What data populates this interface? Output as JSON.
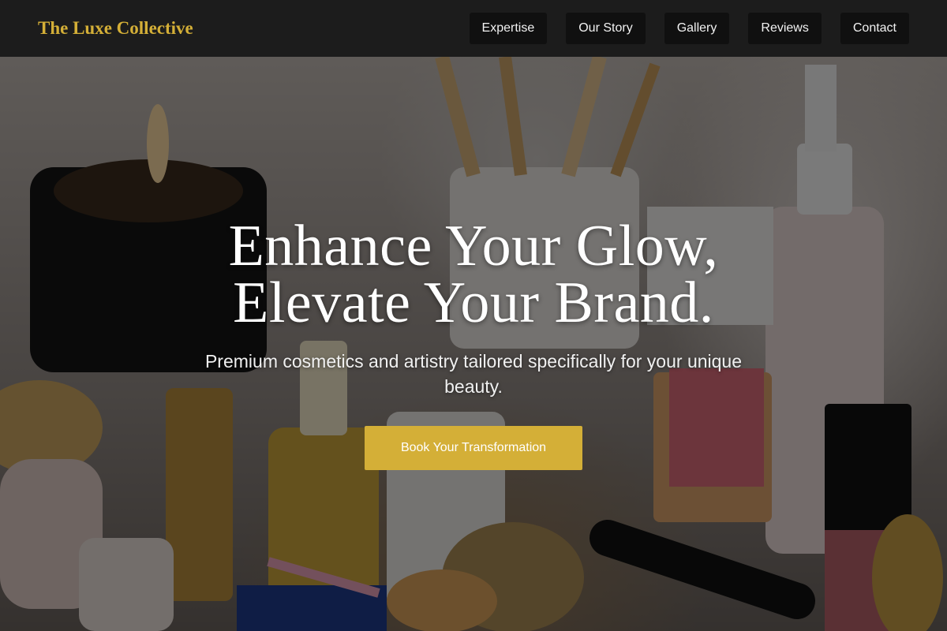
{
  "brand": {
    "name": "The Luxe Collective"
  },
  "nav": {
    "items": [
      {
        "label": "Expertise"
      },
      {
        "label": "Our Story"
      },
      {
        "label": "Gallery"
      },
      {
        "label": "Reviews"
      },
      {
        "label": "Contact"
      }
    ]
  },
  "hero": {
    "headline_line1": "Enhance Your Glow,",
    "headline_line2": "Elevate Your Brand.",
    "subheadline": "Premium cosmetics and artistry tailored specifically for your unique beauty.",
    "cta_label": "Book Your Transformation",
    "background_image": "cosmetics-vanity-photo"
  },
  "colors": {
    "accent": "#d4af37",
    "navbar_bg": "#1c1c1c",
    "nav_button_bg": "#101010",
    "text_light": "#ffffff"
  }
}
